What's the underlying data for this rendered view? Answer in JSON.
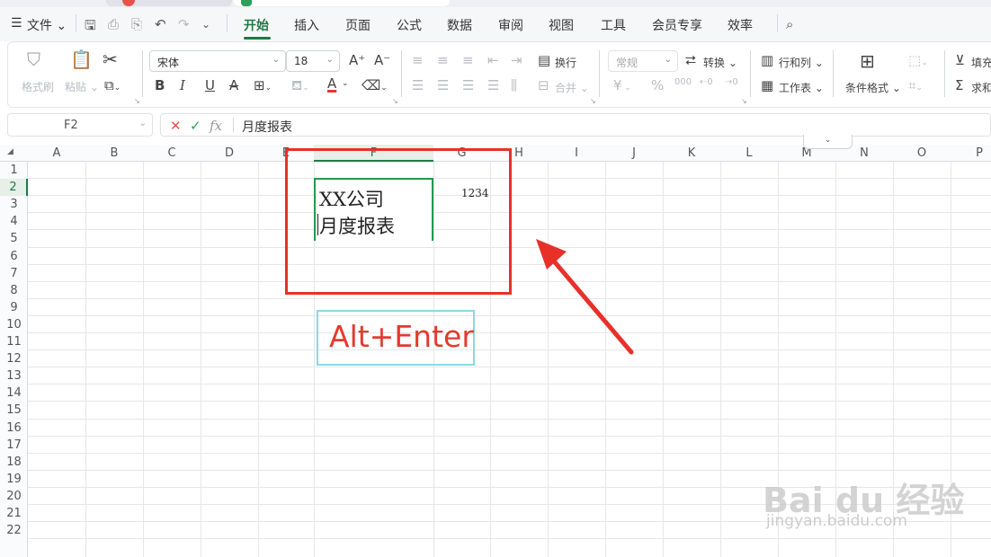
{
  "menu": {
    "file_label": "文件",
    "tabs": [
      {
        "label": "开始",
        "active": true
      },
      {
        "label": "插入"
      },
      {
        "label": "页面"
      },
      {
        "label": "公式"
      },
      {
        "label": "数据"
      },
      {
        "label": "审阅"
      },
      {
        "label": "视图"
      },
      {
        "label": "工具"
      },
      {
        "label": "会员专享"
      },
      {
        "label": "效率"
      }
    ]
  },
  "ribbon": {
    "format_painter": "格式刷",
    "paste": "粘贴",
    "font_name": "宋体",
    "font_size": "18",
    "wrap_text": "换行",
    "merge": "合并",
    "number_format": "常规",
    "convert": "转换",
    "rows_cols": "行和列",
    "worksheet": "工作表",
    "conditional_format": "条件格式",
    "fill": "填充",
    "sum": "求和",
    "bold": "B",
    "italic": "I",
    "underline": "U",
    "strike": "A",
    "font_color": "A",
    "grow_font": "A⁺",
    "shrink_font": "A⁻",
    "percent": "%",
    "currency": "¥",
    "thousands": "000"
  },
  "formula_bar": {
    "cell_ref": "F2",
    "cancel_icon": "✕",
    "confirm_icon": "✓",
    "fx_label": "fx",
    "content": "月度报表"
  },
  "columns": [
    "A",
    "B",
    "C",
    "D",
    "E",
    "F",
    "G",
    "H",
    "I",
    "J",
    "K",
    "L",
    "M",
    "N",
    "O",
    "P"
  ],
  "selected_column": "F",
  "rows": [
    "1",
    "2",
    "3",
    "4",
    "5",
    "6",
    "7",
    "8",
    "9",
    "10",
    "11",
    "12",
    "13",
    "14",
    "15",
    "16",
    "17",
    "18",
    "19",
    "20",
    "21",
    "22"
  ],
  "selected_row": "2",
  "cells": {
    "F2_line1": "XX公司",
    "F2_line2": "月度报表",
    "G2": "1234"
  },
  "annotation": {
    "shortcut": "Alt+Enter",
    "highlight_color": "#e8302a",
    "hint_border_color": "#8fd6e6"
  },
  "watermark": {
    "logo": "Bai du 经验",
    "url": "jingyan.baidu.com"
  },
  "colors": {
    "accent": "#1f7a44",
    "active_cell_border": "#1f9a4c"
  }
}
